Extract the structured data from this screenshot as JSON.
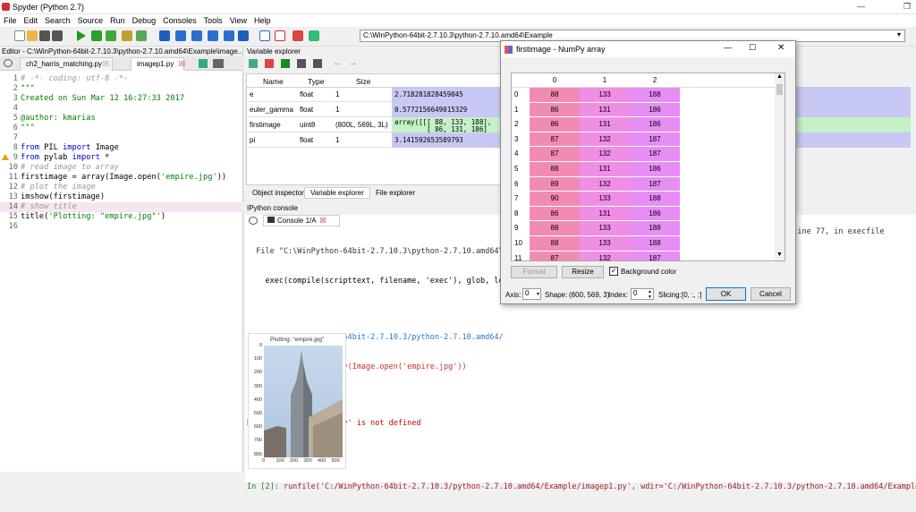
{
  "app": {
    "title": "Spyder (Python 2.7)"
  },
  "menu": [
    "File",
    "Edit",
    "Search",
    "Source",
    "Run",
    "Debug",
    "Consoles",
    "Tools",
    "View",
    "Help"
  ],
  "path": "C:\\WinPython-64bit-2.7.10.3\\python-2.7.10.amd64\\Example",
  "editor": {
    "header": "Editor - C:\\WinPython-64bit-2.7.10.3\\python-2.7.10.amd64\\Example\\image...",
    "tabs": [
      "ch2_harris_matching.py",
      "imagep1.py"
    ],
    "lines": [
      {
        "n": "1",
        "t": "# -*- coding: utf-8 -*-"
      },
      {
        "n": "2",
        "t": "\"\"\""
      },
      {
        "n": "3",
        "t": "Created on Sun Mar 12 16:27:33 2017"
      },
      {
        "n": "4",
        "t": ""
      },
      {
        "n": "5",
        "t": "@author: kmarias"
      },
      {
        "n": "6",
        "t": "\"\"\""
      },
      {
        "n": "7",
        "t": ""
      },
      {
        "n": "8",
        "t": "from PIL import Image"
      },
      {
        "n": "9",
        "t": "from pylab import *"
      },
      {
        "n": "10",
        "t": "# read image to array"
      },
      {
        "n": "11",
        "t": "firstimage = array(Image.open('empire.jpg'))"
      },
      {
        "n": "12",
        "t": "# plot the image"
      },
      {
        "n": "13",
        "t": "imshow(firstimage)"
      },
      {
        "n": "14",
        "t": "# show title"
      },
      {
        "n": "15",
        "t": "title('Plotting: \"empire.jpg\"')"
      },
      {
        "n": "16",
        "t": ""
      }
    ]
  },
  "varexp": {
    "header": "Variable explorer",
    "cols": [
      "Name",
      "Type",
      "Size"
    ],
    "rows": [
      {
        "name": "e",
        "type": "float",
        "size": "1",
        "value": "2.718281828459045"
      },
      {
        "name": "euler_gamma",
        "type": "float",
        "size": "1",
        "value": "0.5772156649015329"
      },
      {
        "name": "firstimage",
        "type": "uint8",
        "size": "(800L, 569L, 3L)",
        "value": "array([[[ 88, 133, 188],",
        "value2": "        [ 86, 131, 186]"
      },
      {
        "name": "pi",
        "type": "float",
        "size": "1",
        "value": "3.141592653589793"
      }
    ],
    "tabs": [
      "Object inspector",
      "Variable explorer",
      "File explorer"
    ]
  },
  "console": {
    "header": "IPython console",
    "tab": "Console 1/A",
    "tb1": "  File \"C:\\WinPython-64bit-2.7.10.3\\python-2.7.10.amd64\\",
    "tb1b": "    exec(compile(scripttext, filename, 'exec'), glob, lo",
    "tb1r": ", line 77, in execfile",
    "tb2": "  File \"C:/WinPython-64bit-2.7.10.3/python-2.7.10.amd64/",
    "tb2b": "    firstimage = array(Image.open('empire.jpg'))",
    "err": "NameError: name 'array' is not defined",
    "prompt": "In [2]:",
    "cmd": " runfile('C:/WinPython-64bit-2.7.10.3/python-2.7.10.amd64/Example/imagep1.py', wdir='C:/WinPython-64bit-2.7.10.3/python-2.7.10.amd64/Example')",
    "plot_title": "Plotting: \"empire.jpg\"",
    "yticks": [
      "0",
      "100",
      "200",
      "300",
      "400",
      "500",
      "600",
      "700",
      "800"
    ],
    "xticks": [
      "0",
      "100",
      "200",
      "300",
      "400",
      "500"
    ]
  },
  "dialog": {
    "title": "firstimage - NumPy array",
    "cols": [
      "0",
      "1",
      "2"
    ],
    "rows": [
      [
        88,
        133,
        188
      ],
      [
        86,
        131,
        186
      ],
      [
        86,
        131,
        186
      ],
      [
        87,
        132,
        187
      ],
      [
        87,
        132,
        187
      ],
      [
        88,
        131,
        186
      ],
      [
        89,
        132,
        187
      ],
      [
        90,
        133,
        188
      ],
      [
        86,
        131,
        186
      ],
      [
        88,
        133,
        188
      ],
      [
        88,
        133,
        188
      ],
      [
        87,
        132,
        187
      ]
    ],
    "format": "Format",
    "resize": "Resize",
    "bgcolor": "Background color",
    "axis_label": "Axis:",
    "axis_value": "0",
    "shape_label": "Shape:",
    "shape_value": "(800, 569, 3)",
    "index_label": "Index:",
    "index_value": "0",
    "slicing_label": "Slicing:",
    "slicing_value": "[0, :, :]",
    "ok": "OK",
    "cancel": "Cancel"
  }
}
